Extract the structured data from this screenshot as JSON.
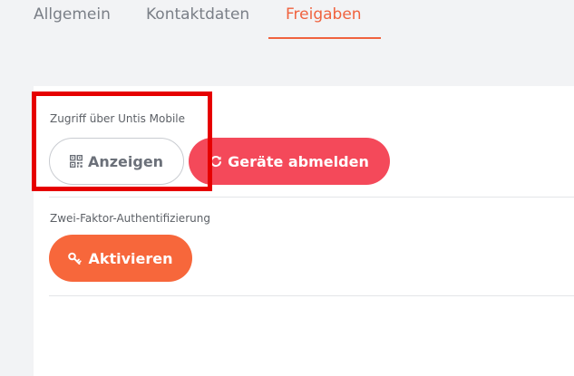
{
  "tabs": [
    {
      "label": "Allgemein"
    },
    {
      "label": "Kontaktdaten"
    },
    {
      "label": "Freigaben",
      "active": true
    }
  ],
  "sections": {
    "untis_mobile": {
      "label": "Zugriff über Untis Mobile",
      "show_button": "Anzeigen",
      "show_icon": "qr-code-icon",
      "logout_button": "Geräte abmelden",
      "logout_icon": "refresh-icon"
    },
    "two_factor": {
      "label": "Zwei-Faktor-Authentifizierung",
      "activate_button": "Aktivieren",
      "activate_icon": "key-icon"
    }
  },
  "colors": {
    "accent": "#f0623e",
    "danger": "#f4495a",
    "activate": "#f7673b",
    "highlight": "#e60000"
  }
}
